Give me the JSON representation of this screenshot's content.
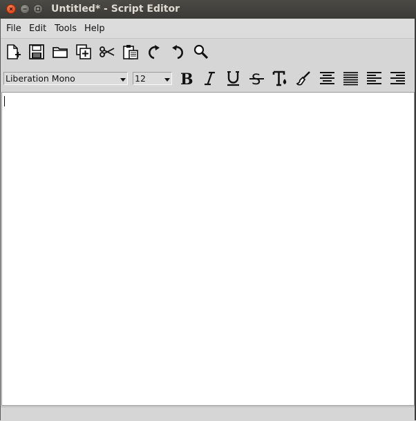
{
  "window": {
    "title": "Untitled* - Script Editor"
  },
  "menubar": {
    "items": [
      {
        "label": "File"
      },
      {
        "label": "Edit"
      },
      {
        "label": "Tools"
      },
      {
        "label": "Help"
      }
    ]
  },
  "toolbar": {
    "buttons": [
      {
        "icon": "new-file-icon"
      },
      {
        "icon": "save-icon"
      },
      {
        "icon": "open-folder-icon"
      },
      {
        "icon": "add-copy-icon"
      },
      {
        "icon": "cut-icon"
      },
      {
        "icon": "paste-icon"
      },
      {
        "icon": "redo-icon"
      },
      {
        "icon": "undo-icon"
      },
      {
        "icon": "find-icon"
      }
    ]
  },
  "format": {
    "font_family": "Liberation Mono",
    "font_size": "12",
    "buttons": [
      {
        "icon": "bold-icon"
      },
      {
        "icon": "italic-icon"
      },
      {
        "icon": "underline-icon"
      },
      {
        "icon": "strikethrough-icon"
      },
      {
        "icon": "text-color-icon"
      },
      {
        "icon": "brush-icon"
      },
      {
        "icon": "align-center-icon"
      },
      {
        "icon": "align-justify-icon"
      },
      {
        "icon": "align-left-icon"
      },
      {
        "icon": "align-right-icon"
      }
    ]
  },
  "editor": {
    "content": ""
  },
  "statusbar": {
    "text": ""
  }
}
